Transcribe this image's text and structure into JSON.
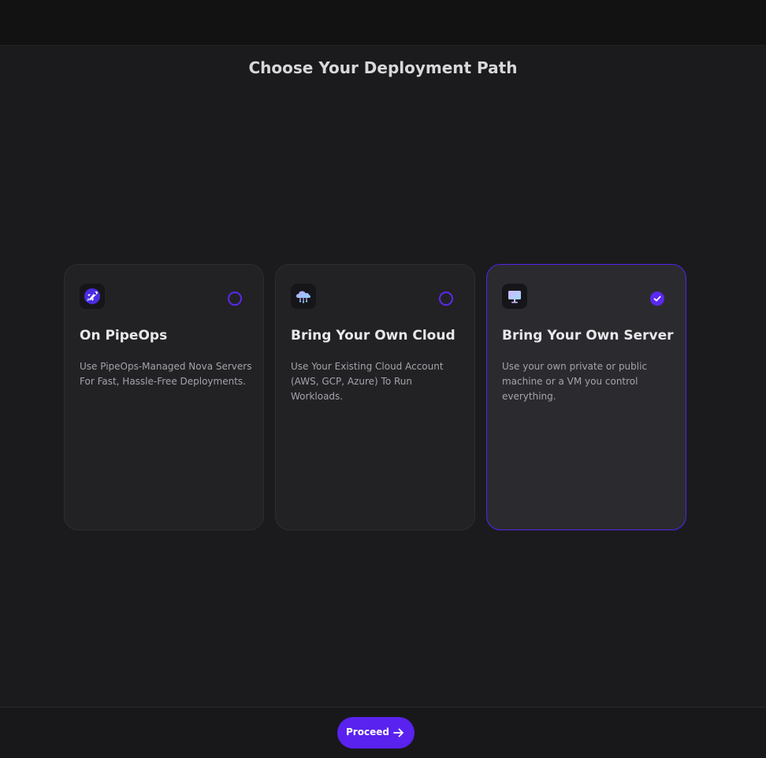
{
  "page": {
    "title": "Choose Your Deployment Path"
  },
  "options": [
    {
      "title": "On PipeOps",
      "description": "Use PipeOps-Managed Nova Servers For Fast, Hassle-Free Deployments.",
      "icon": "rocket-icon",
      "selected": false
    },
    {
      "title": "Bring Your Own Cloud",
      "description": "Use Your Existing Cloud Account (AWS, GCP, Azure) To Run Workloads.",
      "icon": "cloud-icon",
      "selected": false
    },
    {
      "title": "Bring Your Own Server",
      "description": "Use your own private or public machine or a VM you control everything.",
      "icon": "monitor-icon",
      "selected": true
    }
  ],
  "footer": {
    "proceed_label": "Proceed"
  },
  "colors": {
    "accent": "#5a22ee",
    "background": "#1b1b1d",
    "card": "#222225",
    "card_selected": "#2b2b2f"
  }
}
